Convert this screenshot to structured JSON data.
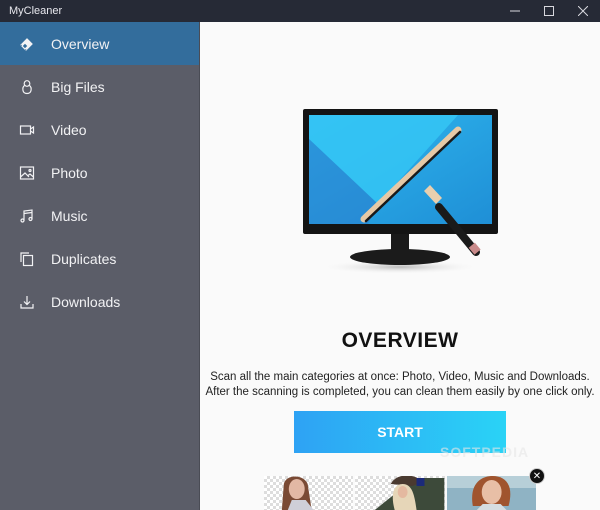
{
  "window": {
    "title": "MyCleaner",
    "controls": {
      "minimize": "—",
      "maximize": "☐",
      "close": "✕"
    }
  },
  "sidebar": {
    "items": [
      {
        "label": "Overview",
        "icon": "eraser-icon",
        "active": true
      },
      {
        "label": "Big Files",
        "icon": "weight-icon",
        "active": false
      },
      {
        "label": "Video",
        "icon": "video-camera-icon",
        "active": false
      },
      {
        "label": "Photo",
        "icon": "image-icon",
        "active": false
      },
      {
        "label": "Music",
        "icon": "music-note-icon",
        "active": false
      },
      {
        "label": "Duplicates",
        "icon": "copy-icon",
        "active": false
      },
      {
        "label": "Downloads",
        "icon": "download-icon",
        "active": false
      }
    ]
  },
  "main": {
    "heading": "OVERVIEW",
    "description_line1": "Scan all the main categories at once: Photo, Video, Music and Downloads.",
    "description_line2": "After the scanning is completed, you can clean them easily by one click only.",
    "start_label": "START",
    "watermark": "SOFTPEDIA",
    "ad_close": "✕"
  },
  "colors": {
    "titlebar": "#262a36",
    "sidebar": "#5b5d68",
    "active_item": "#336d9c",
    "button_start": "#2ea2f4",
    "button_end": "#2ad3f6"
  }
}
